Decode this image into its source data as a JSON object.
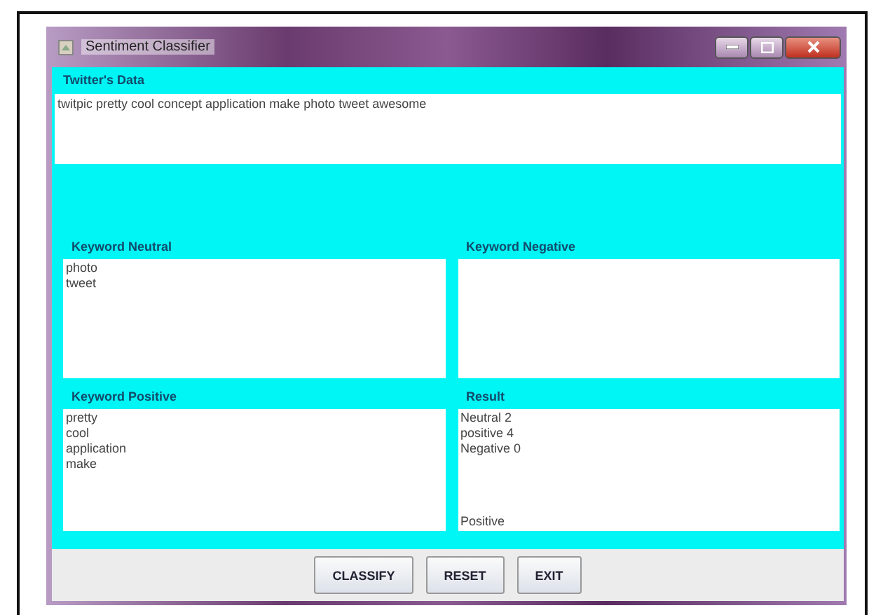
{
  "window": {
    "title": "Sentiment Classifier"
  },
  "twitter_data": {
    "label": "Twitter's Data",
    "value": "twitpic pretty cool concept application make photo tweet awesome"
  },
  "panels": [
    {
      "label": "Keyword Neutral",
      "lines": [
        "photo",
        "tweet"
      ]
    },
    {
      "label": "Keyword Negative"
    },
    {
      "label": "Keyword Positive",
      "lines": [
        "pretty",
        "cool",
        "application",
        "make"
      ]
    },
    {
      "label": "Result",
      "lines": [
        "Neutral 2",
        "positive 4",
        "Negative 0"
      ],
      "verdict": "Positive"
    }
  ],
  "buttons": [
    "CLASSIFY",
    "RESET",
    "EXIT"
  ]
}
